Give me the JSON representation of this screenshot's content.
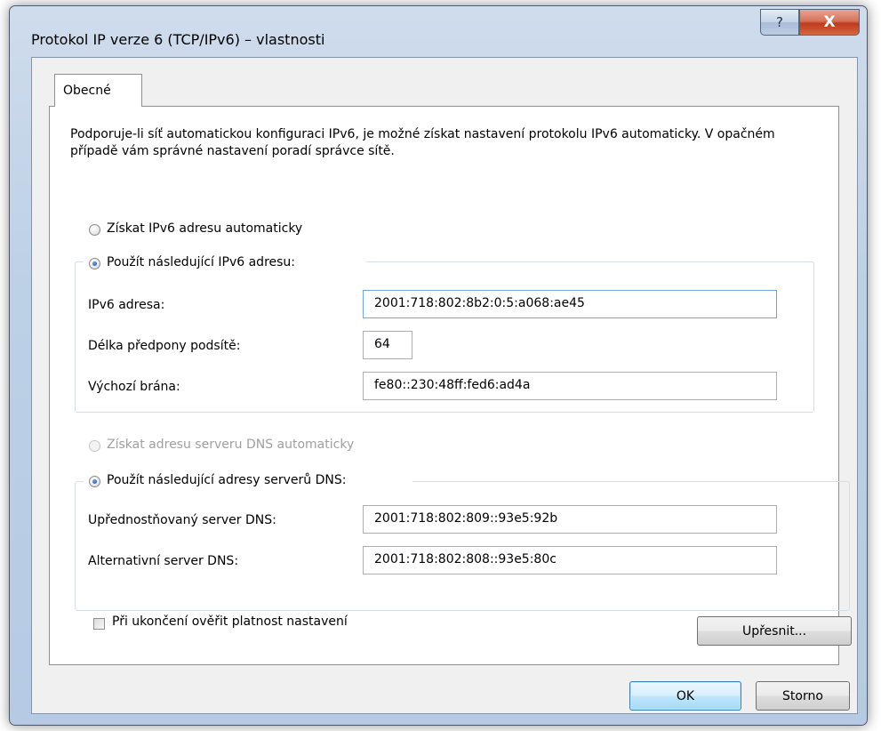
{
  "window": {
    "title": "Protokol IP verze 6 (TCP/IPv6) – vlastnosti",
    "help_glyph": "?",
    "close_glyph": "X"
  },
  "tabs": [
    {
      "label": "Obecné",
      "selected": true
    }
  ],
  "description": "Podporuje-li síť automatickou konfiguraci IPv6, je možné získat nastavení protokolu IPv6 automaticky. V opačném případě vám správné nastavení poradí správce sítě.",
  "ip": {
    "auto_label": "Získat IPv6 adresu automaticky",
    "auto_checked": false,
    "manual_label": "Použít následující IPv6 adresu:",
    "manual_checked": true,
    "fields": [
      {
        "label": "IPv6 adresa:",
        "value": "2001:718:802:8b2:0:5:a068:ae45"
      },
      {
        "label": "Délka předpony podsítě:",
        "value": "64"
      },
      {
        "label": "Výchozí brána:",
        "value": "fe80::230:48ff:fed6:ad4a"
      }
    ]
  },
  "dns": {
    "auto_label": "Získat adresu serveru DNS automaticky",
    "auto_enabled": false,
    "manual_label": "Použít následující adresy serverů DNS:",
    "manual_checked": true,
    "fields": [
      {
        "label": "Upřednostňovaný server DNS:",
        "value": "2001:718:802:809::93e5:92b"
      },
      {
        "label": "Alternativní server DNS:",
        "value": "2001:718:802:808::93e5:80c"
      }
    ]
  },
  "validate": {
    "label": "Při ukončení ověřit platnost nastavení",
    "checked": false
  },
  "buttons": {
    "advanced": "Upřesnit...",
    "ok": "OK",
    "cancel": "Storno"
  },
  "colors": {
    "frame": "#bcd0e6",
    "close": "#c9452a",
    "focus_border": "#6fa8d8"
  }
}
